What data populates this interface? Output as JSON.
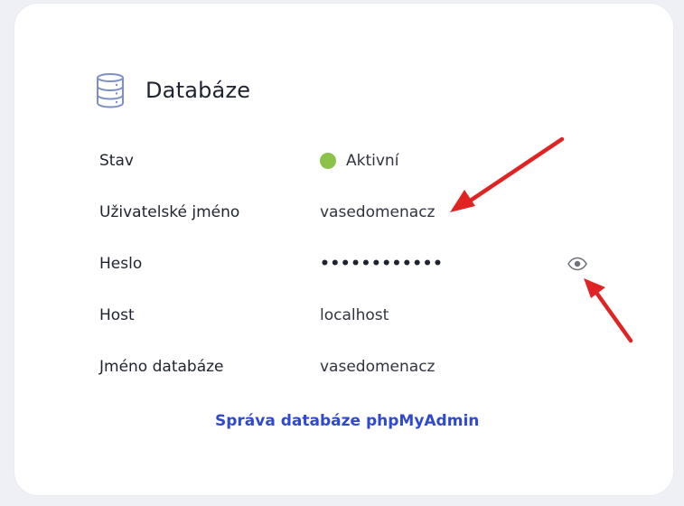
{
  "card": {
    "title": "Databáze",
    "icon": "database-icon"
  },
  "rows": [
    {
      "label": "Stav",
      "value": "Aktivní",
      "status_color": "#8bc34a"
    },
    {
      "label": "Uživatelské jméno",
      "value": "vasedomenacz"
    },
    {
      "label": "Heslo",
      "value": "••••••••••••",
      "action_icon": "eye-icon"
    },
    {
      "label": "Host",
      "value": "localhost"
    },
    {
      "label": "Jméno databáze",
      "value": "vasedomenacz"
    }
  ],
  "link": {
    "label": "Správa databáze phpMyAdmin",
    "color": "#2f49d1"
  },
  "annotations": {
    "arrow_color": "#e02424"
  }
}
